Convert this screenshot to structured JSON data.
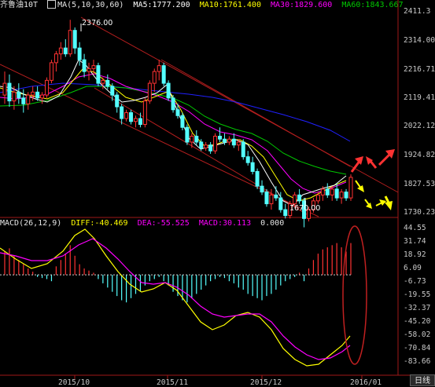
{
  "instrument": {
    "name": "齐鲁油10T",
    "indicator_label": "MA",
    "indicator_params": "(5,10,30,60)",
    "settings_icon": "gear-icon"
  },
  "ma": {
    "ma5": {
      "label": "MA5:1777.200",
      "color": "#ffffff"
    },
    "ma10": {
      "label": "MA10:1761.400",
      "color": "#ffff00"
    },
    "ma30": {
      "label": "MA30:1829.600",
      "color": "#ff00ff"
    },
    "ma60": {
      "label": "MA60:1843.667",
      "color": "#00c800"
    }
  },
  "price_axis": [
    "2411.3",
    "2314.00",
    "2216.71",
    "2119.41",
    "2022.12",
    "1924.82",
    "1827.53",
    "1730.23"
  ],
  "annotations": {
    "high": "2376.00",
    "low": "1670.00"
  },
  "macd": {
    "label": "MACD(26,12,9)",
    "diff": "DIFF:-40.469",
    "dea": "DEA:-55.525",
    "macd": "MACD:30.113",
    "extra": "0.000"
  },
  "macd_axis": [
    "44.55",
    "31.74",
    "18.92",
    "6.09",
    "-6.73",
    "-19.55",
    "-32.37",
    "-45.20",
    "-58.02",
    "-70.84",
    "-83.66"
  ],
  "dates": [
    "2015/10",
    "2015/11",
    "2015/12",
    "2016/01"
  ],
  "period_button": "日线",
  "colors": {
    "up": "#ff3232",
    "down": "#54ffff",
    "ma5": "#ffffff",
    "ma10": "#ffff00",
    "ma30": "#ff00ff",
    "ma60": "#00c800",
    "ma_long": "#2020ff",
    "channel": "#b41e1e",
    "arrow_up": "#ff3232",
    "arrow_down": "#ffff00"
  },
  "chart_data": {
    "type": "candlestick",
    "price_axis_ticks": [
      2411.3,
      2314.0,
      2216.71,
      2119.41,
      2022.12,
      1924.82,
      1827.53,
      1730.23
    ],
    "ohlc": [
      [
        2120,
        2200,
        2090,
        2160
      ],
      [
        2160,
        2190,
        2080,
        2100
      ],
      [
        2100,
        2150,
        2070,
        2130
      ],
      [
        2130,
        2160,
        2090,
        2110
      ],
      [
        2110,
        2140,
        2060,
        2090
      ],
      [
        2090,
        2130,
        2070,
        2120
      ],
      [
        2120,
        2150,
        2100,
        2130
      ],
      [
        2130,
        2150,
        2100,
        2110
      ],
      [
        2110,
        2130,
        2090,
        2120
      ],
      [
        2120,
        2180,
        2110,
        2170
      ],
      [
        2170,
        2240,
        2160,
        2230
      ],
      [
        2230,
        2270,
        2200,
        2260
      ],
      [
        2260,
        2300,
        2240,
        2280
      ],
      [
        2280,
        2310,
        2250,
        2260
      ],
      [
        2260,
        2376,
        2250,
        2340
      ],
      [
        2340,
        2350,
        2260,
        2280
      ],
      [
        2280,
        2300,
        2220,
        2240
      ],
      [
        2240,
        2260,
        2180,
        2200
      ],
      [
        2200,
        2230,
        2170,
        2210
      ],
      [
        2210,
        2240,
        2190,
        2220
      ],
      [
        2220,
        2230,
        2150,
        2160
      ],
      [
        2160,
        2180,
        2140,
        2170
      ],
      [
        2170,
        2190,
        2140,
        2150
      ],
      [
        2150,
        2160,
        2100,
        2120
      ],
      [
        2120,
        2130,
        2060,
        2080
      ],
      [
        2080,
        2090,
        2020,
        2040
      ],
      [
        2040,
        2070,
        2030,
        2060
      ],
      [
        2060,
        2070,
        2020,
        2030
      ],
      [
        2030,
        2050,
        2010,
        2040
      ],
      [
        2040,
        2060,
        2010,
        2020
      ],
      [
        2020,
        2110,
        2010,
        2100
      ],
      [
        2100,
        2170,
        2090,
        2160
      ],
      [
        2160,
        2210,
        2130,
        2200
      ],
      [
        2200,
        2240,
        2170,
        2220
      ],
      [
        2220,
        2230,
        2150,
        2160
      ],
      [
        2160,
        2170,
        2100,
        2110
      ],
      [
        2110,
        2120,
        2060,
        2070
      ],
      [
        2070,
        2090,
        2040,
        2050
      ],
      [
        2050,
        2060,
        2000,
        2010
      ],
      [
        2010,
        2020,
        1950,
        1960
      ],
      [
        1960,
        1990,
        1940,
        1980
      ],
      [
        1980,
        2000,
        1950,
        1960
      ],
      [
        1960,
        1970,
        1930,
        1940
      ],
      [
        1940,
        1960,
        1930,
        1950
      ],
      [
        1950,
        1960,
        1920,
        1930
      ],
      [
        1930,
        1990,
        1920,
        1980
      ],
      [
        1980,
        2010,
        1960,
        1970
      ],
      [
        1970,
        1990,
        1950,
        1960
      ],
      [
        1960,
        1980,
        1950,
        1970
      ],
      [
        1970,
        1990,
        1940,
        1950
      ],
      [
        1950,
        1970,
        1930,
        1960
      ],
      [
        1960,
        1970,
        1900,
        1910
      ],
      [
        1910,
        1930,
        1880,
        1890
      ],
      [
        1890,
        1910,
        1850,
        1860
      ],
      [
        1860,
        1870,
        1800,
        1810
      ],
      [
        1810,
        1830,
        1780,
        1790
      ],
      [
        1790,
        1800,
        1740,
        1750
      ],
      [
        1750,
        1800,
        1730,
        1780
      ],
      [
        1780,
        1810,
        1760,
        1770
      ],
      [
        1770,
        1790,
        1720,
        1730
      ],
      [
        1730,
        1750,
        1700,
        1710
      ],
      [
        1710,
        1760,
        1700,
        1750
      ],
      [
        1750,
        1790,
        1740,
        1780
      ],
      [
        1780,
        1800,
        1750,
        1760
      ],
      [
        1760,
        1770,
        1670,
        1700
      ],
      [
        1700,
        1740,
        1690,
        1730
      ],
      [
        1730,
        1770,
        1720,
        1760
      ],
      [
        1760,
        1790,
        1750,
        1780
      ],
      [
        1780,
        1810,
        1760,
        1800
      ],
      [
        1800,
        1820,
        1770,
        1780
      ],
      [
        1780,
        1810,
        1760,
        1800
      ],
      [
        1800,
        1820,
        1760,
        1770
      ],
      [
        1770,
        1800,
        1750,
        1790
      ],
      [
        1790,
        1800,
        1760,
        1770
      ],
      [
        1770,
        1850,
        1760,
        1840
      ]
    ],
    "macd_axis_ticks": [
      44.55,
      31.74,
      18.92,
      6.09,
      -6.73,
      -19.55,
      -32.37,
      -45.2,
      -58.02,
      -70.84,
      -83.66
    ],
    "macd_hist": [
      22,
      25,
      18,
      14,
      10,
      6,
      3,
      -2,
      -3,
      -4,
      -6,
      8,
      14,
      20,
      28,
      18,
      10,
      6,
      4,
      2,
      -4,
      -8,
      -12,
      -16,
      -20,
      -24,
      -26,
      -22,
      -18,
      -16,
      -10,
      -6,
      -4,
      -2,
      -6,
      -10,
      -16,
      -20,
      -24,
      -26,
      -22,
      -18,
      -14,
      -10,
      -6,
      -4,
      -2,
      -3,
      -6,
      -8,
      -12,
      -14,
      -18,
      -20,
      -22,
      -24,
      -20,
      -18,
      -14,
      -10,
      -6,
      -4,
      -2,
      2,
      -6,
      6,
      14,
      20,
      24,
      26,
      28,
      30,
      26,
      22,
      30
    ]
  }
}
